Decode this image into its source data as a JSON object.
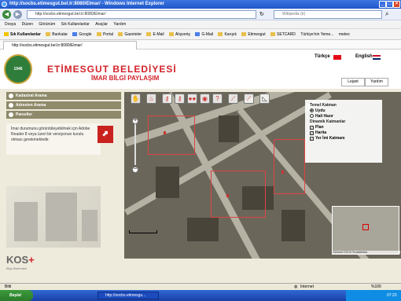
{
  "window": {
    "title": "http://socbs.etimesgut.bel.tr:8080/Elmar/ - Windows Internet Explorer"
  },
  "address": {
    "url": "http://socbs.etimesgut.bel.tr:8080/Elmar/",
    "search_placeholder": "Wikipedia (tr)"
  },
  "menu": [
    "Dosya",
    "Düzen",
    "Görünüm",
    "Sık Kullanılanlar",
    "Araçlar",
    "Yardım"
  ],
  "favorites": [
    "Sık Kullanılanlar",
    "Bankalar",
    "Google",
    "Portal",
    "Gazeteler",
    "E-Mail",
    "Alışveriş",
    "G-Mail",
    "Karışık",
    "Etimesgut",
    "SETCARD",
    "Türkiye'nin Yeme...",
    "meteo"
  ],
  "tab": {
    "label": "http://socbs.etimesgut.bel.tr:8080/Elmar/"
  },
  "header": {
    "brand_line1": "ETİMESGUT BELEDİYESİ",
    "brand_line2": "İMAR BİLGİ PAYLAŞIM",
    "logo_text": "ETİMESGUT BELEDİYESİ",
    "logo_year": "1946",
    "lang_tr": "Türkçe",
    "lang_en": "English",
    "btn_legend": "Lejant",
    "btn_help": "Yardım"
  },
  "sidebar": {
    "sections": [
      "Kadastral Arama",
      "Adresten Arama",
      "Parseller"
    ],
    "info_text": "İmar durumunu görüntüleyebilmek için Adobe Reader 8 veya üzeri bir versiyonun kurulu olması gerekmektedir.",
    "pdf_icon": "pdf-icon",
    "footer_brand": "KOS",
    "footer_sub": "Bilgi Sistemleri"
  },
  "layers": {
    "title_base": "Temel Katman",
    "base_options": [
      {
        "label": "Uydu",
        "selected": true
      },
      {
        "label": "Hali Hazır",
        "selected": false
      }
    ],
    "title_dynamic": "Dinamik Katmanlar",
    "dynamic_options": [
      {
        "label": "Plan",
        "checked": true
      },
      {
        "label": "Harita",
        "checked": true
      },
      {
        "label": "Yer İmi Katmanı",
        "checked": true
      }
    ]
  },
  "minimap": {
    "caption": "Görüntü ©2013 TerraMetrics"
  },
  "status": {
    "left": "Bitti",
    "zone": "Internet",
    "zoom": "%100"
  },
  "taskbar": {
    "start": "Başlat",
    "task": "http://socbs.etimesgu...",
    "clock": "07:23"
  },
  "colors": {
    "brand": "#d2232a",
    "accent_panel": "#8e8a6a",
    "page_bg": "#eeeadc"
  }
}
